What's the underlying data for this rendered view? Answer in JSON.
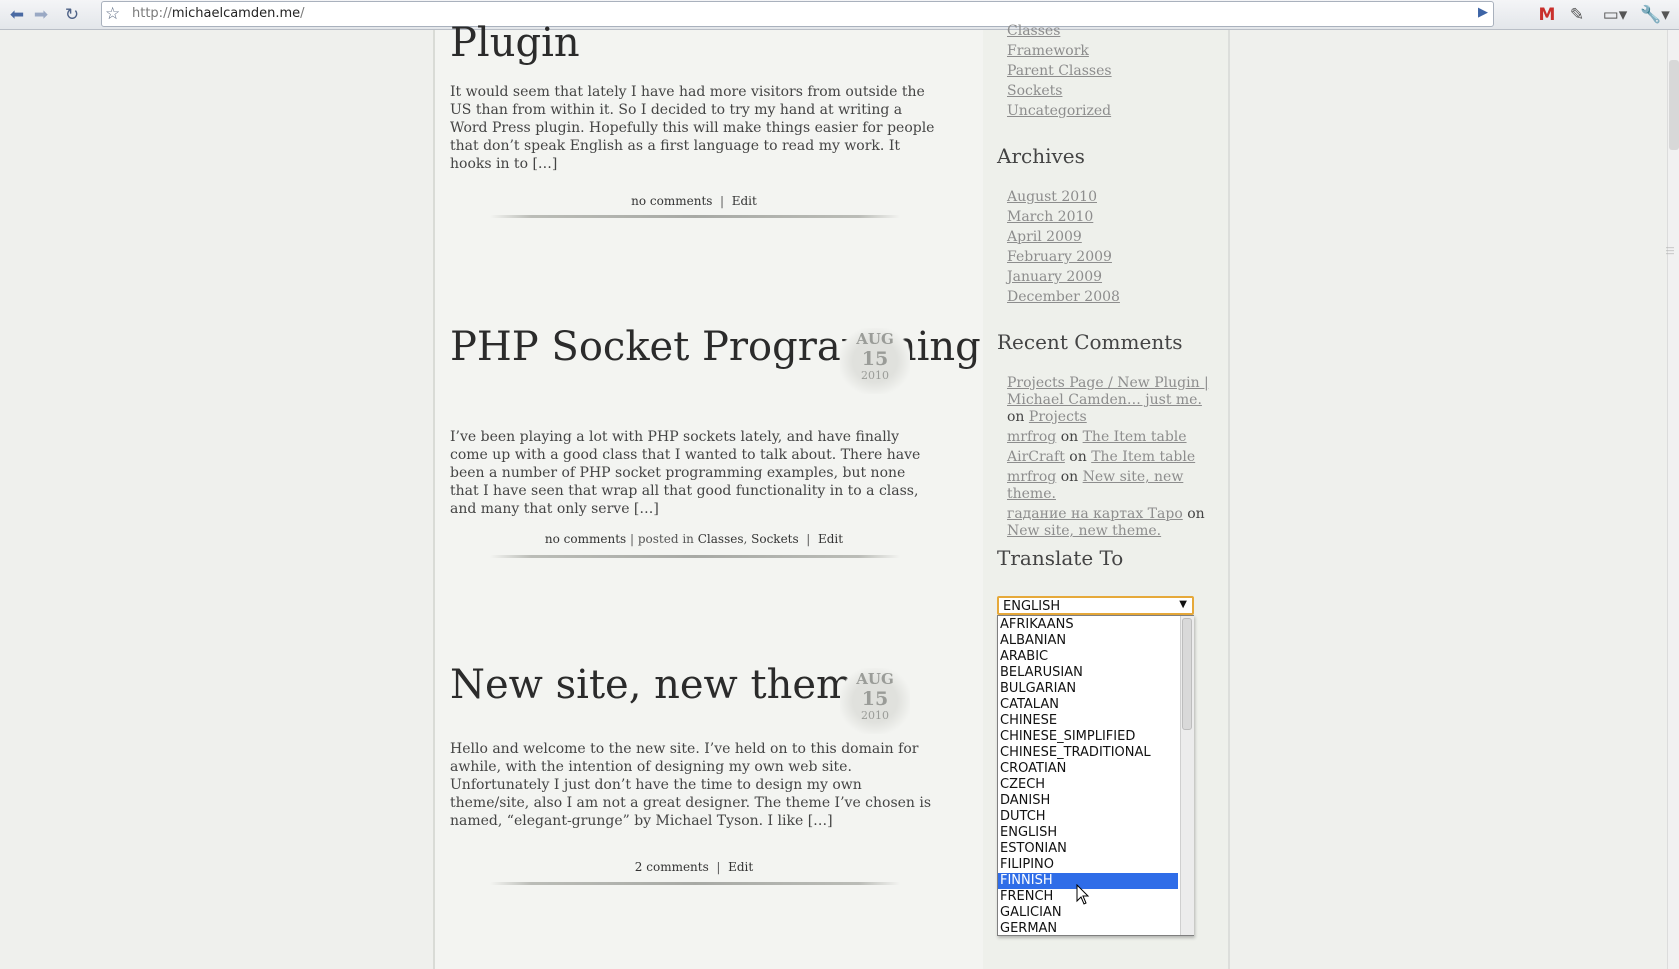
{
  "browser": {
    "url_scheme": "http://",
    "url_host": "michaelcamden.me",
    "url_path": "/"
  },
  "posts": [
    {
      "title": "Plugin",
      "excerpt": "It would seem that lately I have had more visitors from outside the US than from within it. So I decided to try my hand at writing a Word Press plugin. Hopefully this will make things easier for people that don’t speak English as a first language to read my work. It hooks in to […]",
      "comments": "no comments",
      "edit": "Edit"
    },
    {
      "title": "PHP Socket Programming",
      "date": {
        "month": "AUG",
        "day": "15",
        "year": "2010"
      },
      "excerpt": "I’ve been playing a lot with PHP sockets lately, and have finally come up with a good class that I wanted to talk about. There have been a number of PHP socket programming examples, but none that I have seen that wrap all that good functionality in to a class, and many that only serve […]",
      "comments": "no comments",
      "posted_in": "| posted in",
      "categories": [
        "Classes",
        "Sockets"
      ],
      "edit": "Edit"
    },
    {
      "title": "New site, new theme.",
      "date": {
        "month": "AUG",
        "day": "15",
        "year": "2010"
      },
      "excerpt": "Hello and welcome to the new site. I’ve held on to this domain for awhile, with the intention of designing my own web site. Unfortunately I just don’t have the time to design my own theme/site, also I am not a great designer. The theme I’ve chosen is named, “elegant-grunge” by Michael Tyson. I like […]",
      "comments": "2 comments",
      "edit": "Edit"
    }
  ],
  "sidebar": {
    "categories": [
      "Classes",
      "Framework",
      "Parent Classes",
      "Sockets",
      "Uncategorized"
    ],
    "archives_title": "Archives",
    "archives": [
      "August 2010",
      "March 2010",
      "April 2009",
      "February 2009",
      "January 2009",
      "December 2008"
    ],
    "recent_comments_title": "Recent Comments",
    "recent_comments": [
      {
        "author": "Projects Page / New Plugin | Michael Camden… just me.",
        "on": "on",
        "post": "Projects"
      },
      {
        "author": "mrfrog",
        "on": "on",
        "post": "The Item table"
      },
      {
        "author": "AirCraft",
        "on": "on",
        "post": "The Item table"
      },
      {
        "author": "mrfrog",
        "on": "on",
        "post": "New site, new theme."
      },
      {
        "author": "гадание на картах Таро",
        "on": "on",
        "post": "New site, new theme."
      }
    ],
    "translate_title": "Translate To",
    "translate_selected": "ENGLISH",
    "translate_options": [
      "AFRIKAANS",
      "ALBANIAN",
      "ARABIC",
      "BELARUSIAN",
      "BULGARIAN",
      "CATALAN",
      "CHINESE",
      "CHINESE_SIMPLIFIED",
      "CHINESE_TRADITIONAL",
      "CROATIAN",
      "CZECH",
      "DANISH",
      "DUTCH",
      "ENGLISH",
      "ESTONIAN",
      "FILIPINO",
      "FINNISH",
      "FRENCH",
      "GALICIAN",
      "GERMAN"
    ],
    "translate_highlighted": "FINNISH"
  },
  "colors": {
    "highlight": "#2f6de8",
    "select_focus": "#e6a93a",
    "link": "#8d8d8d"
  }
}
